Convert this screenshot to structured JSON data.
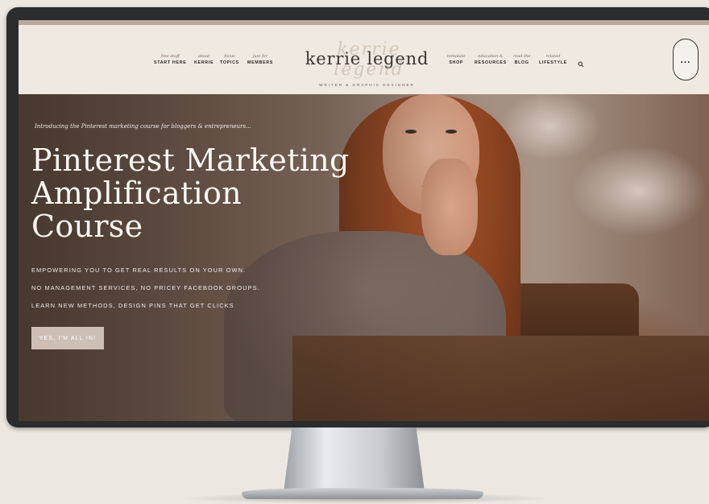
{
  "header": {
    "nav_left": [
      {
        "sub": "free stuff",
        "label": "START HERE"
      },
      {
        "sub": "about",
        "label": "KERRIE"
      },
      {
        "sub": "focus",
        "label": "TOPICS"
      },
      {
        "sub": "just for",
        "label": "MEMBERS"
      }
    ],
    "logo_script": "kerrie legend",
    "logo": "kerrie legend",
    "logo_tagline": "WRITER & GRAPHIC DESIGNER",
    "nav_right": [
      {
        "sub": "template",
        "label": "SHOP"
      },
      {
        "sub": "education &",
        "label": "RESOURCES"
      },
      {
        "sub": "read the",
        "label": "BLOG"
      },
      {
        "sub": "related",
        "label": "LIFESTYLE"
      }
    ],
    "menu_label": "..."
  },
  "hero": {
    "intro": "Introducing the Pinterest marketing course for bloggers & entrepreneurs...",
    "headline_lines": [
      "Pinterest Marketing",
      "Amplification",
      "Course"
    ],
    "taglines": [
      "EMPOWERING YOU TO GET REAL RESULTS ON YOUR OWN.",
      "NO MANAGEMENT SERVICES, NO PRICEY FACEBOOK GROUPS.",
      "LEARN NEW METHODS, DESIGN PINS THAT GET CLICKS"
    ],
    "cta": "YES, I'M ALL IN!"
  },
  "colors": {
    "header_bg": "#efe9e2",
    "page_bg": "#ece8e1",
    "cta_bg": "#cdbfb6"
  }
}
